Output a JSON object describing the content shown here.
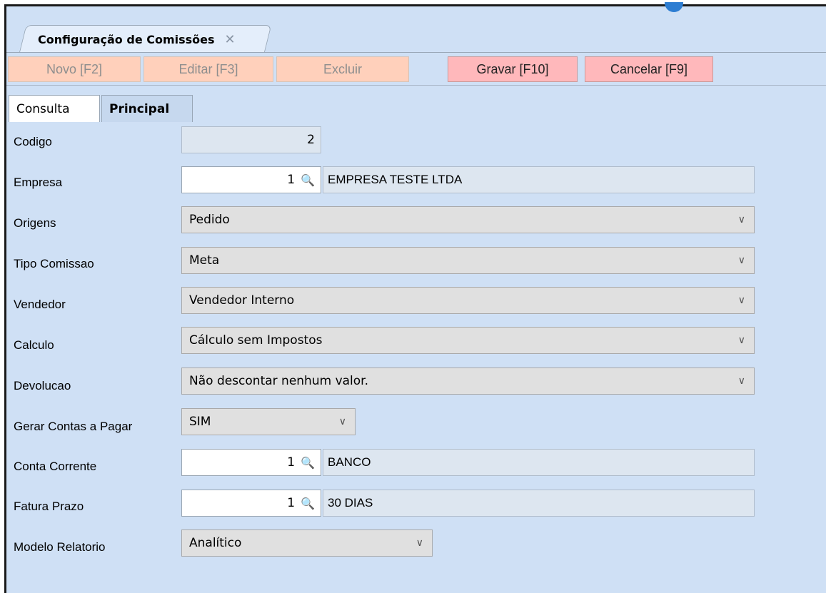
{
  "window": {
    "tab_title": "Configuração de Comissões",
    "close_glyph": "✕"
  },
  "toolbar": {
    "novo": "Novo [F2]",
    "editar": "Editar [F3]",
    "excluir": "Excluir",
    "gravar": "Gravar [F10]",
    "cancelar": "Cancelar [F9]"
  },
  "tabs": {
    "consulta": "Consulta",
    "principal": "Principal"
  },
  "form": {
    "codigo": {
      "label": "Codigo",
      "value": "2"
    },
    "empresa": {
      "label": "Empresa",
      "code": "1",
      "description": "EMPRESA TESTE LTDA"
    },
    "origens": {
      "label": "Origens",
      "value": "Pedido"
    },
    "tipo_comissao": {
      "label": "Tipo Comissao",
      "value": "Meta"
    },
    "vendedor": {
      "label": "Vendedor",
      "value": "Vendedor Interno"
    },
    "calculo": {
      "label": "Calculo",
      "value": "Cálculo sem Impostos"
    },
    "devolucao": {
      "label": "Devolucao",
      "value": "Não descontar nenhum valor."
    },
    "gerar_contas": {
      "label": "Gerar Contas a Pagar",
      "value": "SIM"
    },
    "conta_corrente": {
      "label": "Conta Corrente",
      "code": "1",
      "description": "BANCO"
    },
    "fatura_prazo": {
      "label": "Fatura Prazo",
      "code": "1",
      "description": "30 DIAS"
    },
    "modelo_relatorio": {
      "label": "Modelo Relatorio",
      "value": "Analítico"
    }
  },
  "icons": {
    "lookup": "search-icon",
    "dropdown": "chevron-down-icon"
  }
}
